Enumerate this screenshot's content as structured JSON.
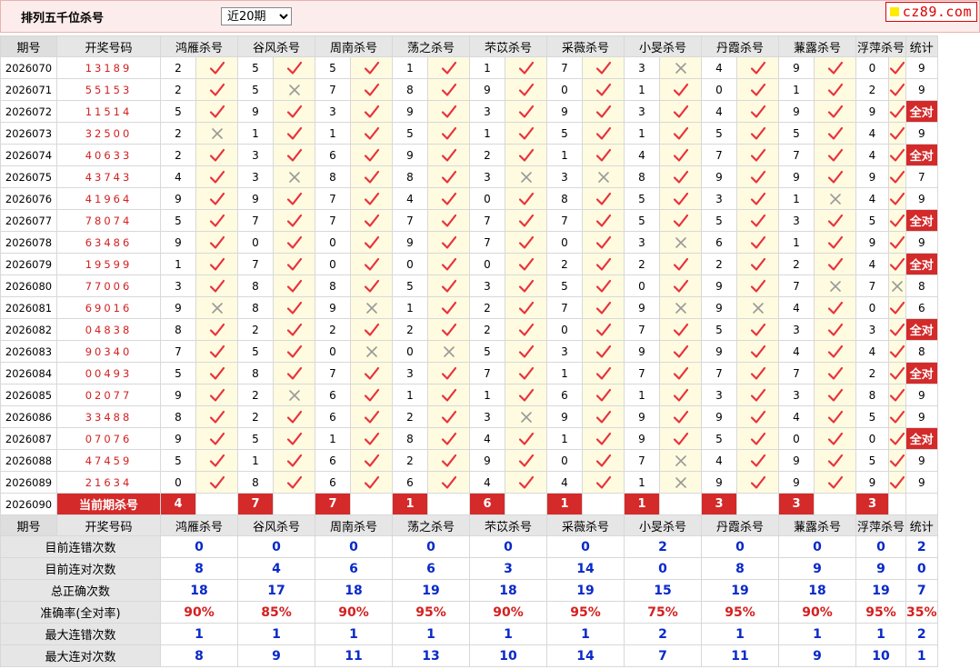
{
  "header": {
    "title": "排列五千位杀号",
    "period_select": "近20期"
  },
  "logo": {
    "text": "cz89.com"
  },
  "columns": {
    "period": "期号",
    "numbers": "开奖号码",
    "stat": "统计",
    "experts": [
      "鸿雁杀号",
      "谷风杀号",
      "周南杀号",
      "荡之杀号",
      "芣苡杀号",
      "采薇杀号",
      "小旻杀号",
      "丹霞杀号",
      "蒹露杀号",
      "浮萍杀号"
    ]
  },
  "rows": [
    {
      "period": "2026070",
      "numbers": "13189",
      "kills": [
        2,
        5,
        5,
        1,
        1,
        7,
        3,
        4,
        9,
        0
      ],
      "ok": [
        1,
        1,
        1,
        1,
        1,
        1,
        0,
        1,
        1,
        1
      ],
      "stat": "9"
    },
    {
      "period": "2026071",
      "numbers": "55153",
      "kills": [
        2,
        5,
        7,
        8,
        9,
        0,
        1,
        0,
        1,
        2
      ],
      "ok": [
        1,
        0,
        1,
        1,
        1,
        1,
        1,
        1,
        1,
        1
      ],
      "stat": "9"
    },
    {
      "period": "2026072",
      "numbers": "11514",
      "kills": [
        5,
        9,
        3,
        9,
        3,
        9,
        3,
        4,
        9,
        9
      ],
      "ok": [
        1,
        1,
        1,
        1,
        1,
        1,
        1,
        1,
        1,
        1
      ],
      "stat": "全对"
    },
    {
      "period": "2026073",
      "numbers": "32500",
      "kills": [
        2,
        1,
        1,
        5,
        1,
        5,
        1,
        5,
        5,
        4
      ],
      "ok": [
        0,
        1,
        1,
        1,
        1,
        1,
        1,
        1,
        1,
        1
      ],
      "stat": "9"
    },
    {
      "period": "2026074",
      "numbers": "40633",
      "kills": [
        2,
        3,
        6,
        9,
        2,
        1,
        4,
        7,
        7,
        4
      ],
      "ok": [
        1,
        1,
        1,
        1,
        1,
        1,
        1,
        1,
        1,
        1
      ],
      "stat": "全对"
    },
    {
      "period": "2026075",
      "numbers": "43743",
      "kills": [
        4,
        3,
        8,
        8,
        3,
        3,
        8,
        9,
        9,
        9
      ],
      "ok": [
        1,
        0,
        1,
        1,
        0,
        0,
        1,
        1,
        1,
        1
      ],
      "stat": "7"
    },
    {
      "period": "2026076",
      "numbers": "41964",
      "kills": [
        9,
        9,
        7,
        4,
        0,
        8,
        5,
        3,
        1,
        4
      ],
      "ok": [
        1,
        1,
        1,
        1,
        1,
        1,
        1,
        1,
        0,
        1
      ],
      "stat": "9"
    },
    {
      "period": "2026077",
      "numbers": "78074",
      "kills": [
        5,
        7,
        7,
        7,
        7,
        7,
        5,
        5,
        3,
        5
      ],
      "ok": [
        1,
        1,
        1,
        1,
        1,
        1,
        1,
        1,
        1,
        1
      ],
      "stat": "全对"
    },
    {
      "period": "2026078",
      "numbers": "63486",
      "kills": [
        9,
        0,
        0,
        9,
        7,
        0,
        3,
        6,
        1,
        9
      ],
      "ok": [
        1,
        1,
        1,
        1,
        1,
        1,
        0,
        1,
        1,
        1
      ],
      "stat": "9"
    },
    {
      "period": "2026079",
      "numbers": "19599",
      "kills": [
        1,
        7,
        0,
        0,
        0,
        2,
        2,
        2,
        2,
        4
      ],
      "ok": [
        1,
        1,
        1,
        1,
        1,
        1,
        1,
        1,
        1,
        1
      ],
      "stat": "全对"
    },
    {
      "period": "2026080",
      "numbers": "77006",
      "kills": [
        3,
        8,
        8,
        5,
        3,
        5,
        0,
        9,
        7,
        7
      ],
      "ok": [
        1,
        1,
        1,
        1,
        1,
        1,
        1,
        1,
        0,
        0
      ],
      "stat": "8"
    },
    {
      "period": "2026081",
      "numbers": "69016",
      "kills": [
        9,
        8,
        9,
        1,
        2,
        7,
        9,
        9,
        4,
        0
      ],
      "ok": [
        0,
        1,
        0,
        1,
        1,
        1,
        0,
        0,
        1,
        1
      ],
      "stat": "6"
    },
    {
      "period": "2026082",
      "numbers": "04838",
      "kills": [
        8,
        2,
        2,
        2,
        2,
        0,
        7,
        5,
        3,
        3
      ],
      "ok": [
        1,
        1,
        1,
        1,
        1,
        1,
        1,
        1,
        1,
        1
      ],
      "stat": "全对"
    },
    {
      "period": "2026083",
      "numbers": "90340",
      "kills": [
        7,
        5,
        0,
        0,
        5,
        3,
        9,
        9,
        4,
        4
      ],
      "ok": [
        1,
        1,
        0,
        0,
        1,
        1,
        1,
        1,
        1,
        1
      ],
      "stat": "8"
    },
    {
      "period": "2026084",
      "numbers": "00493",
      "kills": [
        5,
        8,
        7,
        3,
        7,
        1,
        7,
        7,
        7,
        2
      ],
      "ok": [
        1,
        1,
        1,
        1,
        1,
        1,
        1,
        1,
        1,
        1
      ],
      "stat": "全对"
    },
    {
      "period": "2026085",
      "numbers": "02077",
      "kills": [
        9,
        2,
        6,
        1,
        1,
        6,
        1,
        3,
        3,
        8
      ],
      "ok": [
        1,
        0,
        1,
        1,
        1,
        1,
        1,
        1,
        1,
        1
      ],
      "stat": "9"
    },
    {
      "period": "2026086",
      "numbers": "33488",
      "kills": [
        8,
        2,
        6,
        2,
        3,
        9,
        9,
        9,
        4,
        5
      ],
      "ok": [
        1,
        1,
        1,
        1,
        0,
        1,
        1,
        1,
        1,
        1
      ],
      "stat": "9"
    },
    {
      "period": "2026087",
      "numbers": "07076",
      "kills": [
        9,
        5,
        1,
        8,
        4,
        1,
        9,
        5,
        0,
        0
      ],
      "ok": [
        1,
        1,
        1,
        1,
        1,
        1,
        1,
        1,
        1,
        1
      ],
      "stat": "全对"
    },
    {
      "period": "2026088",
      "numbers": "47459",
      "kills": [
        5,
        1,
        6,
        2,
        9,
        0,
        7,
        4,
        9,
        5
      ],
      "ok": [
        1,
        1,
        1,
        1,
        1,
        1,
        0,
        1,
        1,
        1
      ],
      "stat": "9"
    },
    {
      "period": "2026089",
      "numbers": "21634",
      "kills": [
        0,
        8,
        6,
        6,
        4,
        4,
        1,
        9,
        9,
        9
      ],
      "ok": [
        1,
        1,
        1,
        1,
        1,
        1,
        0,
        1,
        1,
        1
      ],
      "stat": "9"
    }
  ],
  "current": {
    "period": "2026090",
    "label": "当前期杀号",
    "kills": [
      4,
      7,
      7,
      1,
      6,
      1,
      1,
      3,
      3,
      3
    ]
  },
  "summary": [
    {
      "label": "目前连错次数",
      "values": [
        "0",
        "0",
        "0",
        "0",
        "0",
        "0",
        "2",
        "0",
        "0",
        "0"
      ],
      "stat": "2",
      "color": "blue"
    },
    {
      "label": "目前连对次数",
      "values": [
        "8",
        "4",
        "6",
        "6",
        "3",
        "14",
        "0",
        "8",
        "9",
        "9"
      ],
      "stat": "0",
      "color": "blue"
    },
    {
      "label": "总正确次数",
      "values": [
        "18",
        "17",
        "18",
        "19",
        "18",
        "19",
        "15",
        "19",
        "18",
        "19"
      ],
      "stat": "7",
      "color": "blue"
    },
    {
      "label": "准确率(全对率)",
      "values": [
        "90%",
        "85%",
        "90%",
        "95%",
        "90%",
        "95%",
        "75%",
        "95%",
        "90%",
        "95%"
      ],
      "stat": "35%",
      "color": "red"
    },
    {
      "label": "最大连错次数",
      "values": [
        "1",
        "1",
        "1",
        "1",
        "1",
        "1",
        "2",
        "1",
        "1",
        "1"
      ],
      "stat": "2",
      "color": "blue"
    },
    {
      "label": "最大连对次数",
      "values": [
        "8",
        "9",
        "11",
        "13",
        "10",
        "14",
        "7",
        "11",
        "9",
        "10"
      ],
      "stat": "1",
      "color": "blue"
    }
  ],
  "colors": {
    "red": "#d42a2a",
    "blue": "#0a29c9",
    "mark_bg": "#fffbe0",
    "check": "#e8323c",
    "cross": "#999999"
  },
  "icons": {
    "correct": "check-icon",
    "wrong": "cross-icon"
  }
}
